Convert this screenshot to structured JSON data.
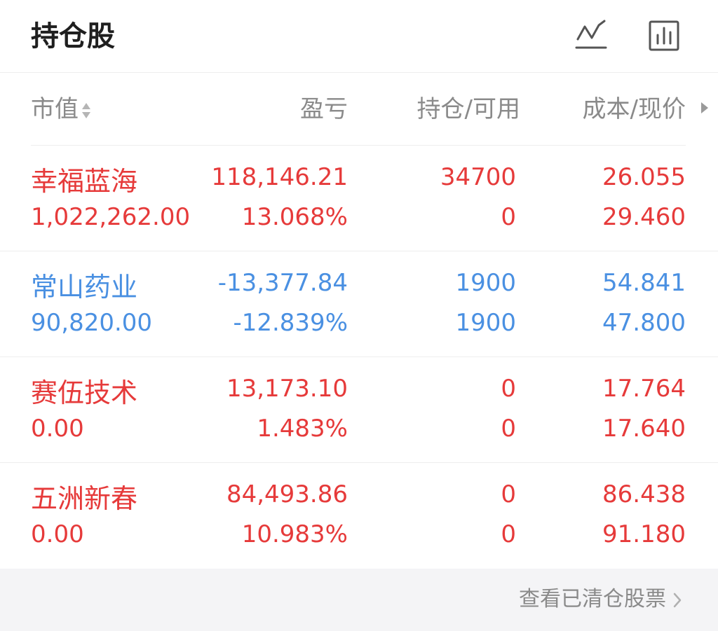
{
  "header": {
    "title": "持仓股",
    "icons": [
      "line-chart-icon",
      "bar-chart-icon"
    ]
  },
  "columns": {
    "market_value": "市值",
    "profit_loss": "盈亏",
    "position": "持仓/可用",
    "cost_price": "成本/现价"
  },
  "colors": {
    "up": "#e63a3a",
    "down": "#4a90e2",
    "muted": "#8a8a8a"
  },
  "rows": [
    {
      "name": "幸福蓝海",
      "market_value": "1,022,262.00",
      "pnl": "118,146.21",
      "pnl_pct": "13.068%",
      "holding": "34700",
      "available": "0",
      "cost": "26.055",
      "price": "29.460",
      "trend": "up"
    },
    {
      "name": "常山药业",
      "market_value": "90,820.00",
      "pnl": "-13,377.84",
      "pnl_pct": "-12.839%",
      "holding": "1900",
      "available": "1900",
      "cost": "54.841",
      "price": "47.800",
      "trend": "down"
    },
    {
      "name": "赛伍技术",
      "market_value": "0.00",
      "pnl": "13,173.10",
      "pnl_pct": "1.483%",
      "holding": "0",
      "available": "0",
      "cost": "17.764",
      "price": "17.640",
      "trend": "up"
    },
    {
      "name": "五洲新春",
      "market_value": "0.00",
      "pnl": "84,493.86",
      "pnl_pct": "10.983%",
      "holding": "0",
      "available": "0",
      "cost": "86.438",
      "price": "91.180",
      "trend": "up"
    }
  ],
  "footer": {
    "link_label": "查看已清仓股票"
  }
}
